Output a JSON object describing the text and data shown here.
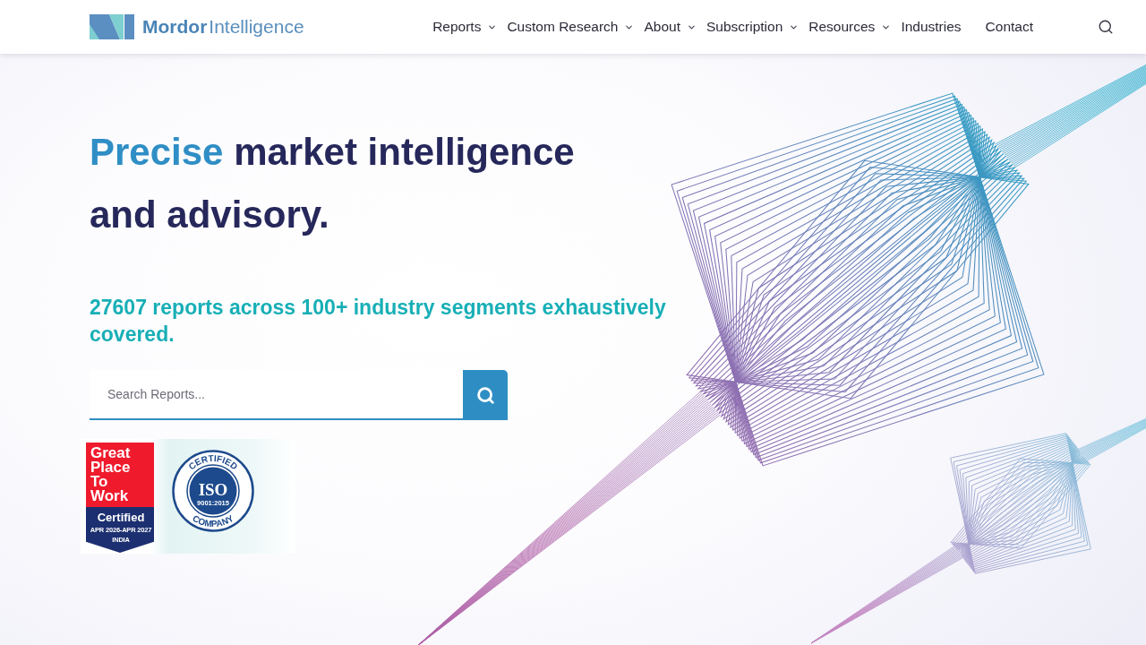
{
  "header": {
    "logo": {
      "primary": "Mordor",
      "secondary": "Intelligence"
    },
    "nav": [
      {
        "label": "Reports",
        "dropdown": true
      },
      {
        "label": "Custom Research",
        "dropdown": true
      },
      {
        "label": "About",
        "dropdown": true
      },
      {
        "label": "Subscription",
        "dropdown": true
      },
      {
        "label": "Resources",
        "dropdown": true
      },
      {
        "label": "Industries",
        "dropdown": false
      },
      {
        "label": "Contact",
        "dropdown": false
      }
    ]
  },
  "hero": {
    "headline": {
      "highlight": "Precise",
      "rest": "market intelligence and advisory."
    },
    "tagline": "27607 reports across 100+ industry segments exhaustively covered.",
    "search": {
      "placeholder": "Search Reports..."
    }
  },
  "badges": [
    {
      "kind": "ribbon",
      "title": "Great Place To Work",
      "label": "Certified",
      "period": "APR 2026-APR 2027",
      "region": "INDIA"
    },
    {
      "kind": "seal",
      "top": "CERTIFIED",
      "center": "ISO",
      "standard": "9001:2015",
      "bottom": "COMPANY"
    }
  ]
}
